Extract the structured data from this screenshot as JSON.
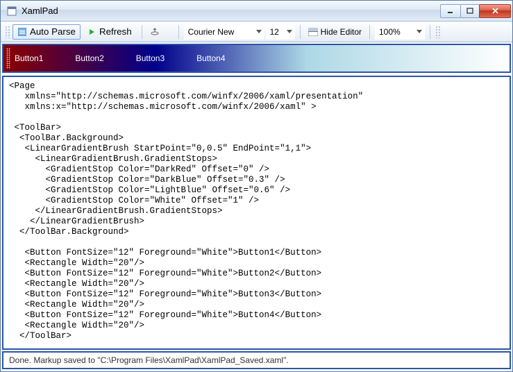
{
  "window": {
    "title": "XamlPad"
  },
  "toolbar": {
    "auto_parse": "Auto Parse",
    "refresh": "Refresh",
    "font": "Courier New",
    "font_size": "12",
    "hide_editor": "Hide Editor",
    "zoom": "100%"
  },
  "preview": {
    "buttons": [
      "Button1",
      "Button2",
      "Button3",
      "Button4"
    ]
  },
  "code": "<Page\n   xmlns=\"http://schemas.microsoft.com/winfx/2006/xaml/presentation\"\n   xmlns:x=\"http://schemas.microsoft.com/winfx/2006/xaml\" >\n\n <ToolBar>\n  <ToolBar.Background>\n   <LinearGradientBrush StartPoint=\"0,0.5\" EndPoint=\"1,1\">\n     <LinearGradientBrush.GradientStops>\n       <GradientStop Color=\"DarkRed\" Offset=\"0\" />\n       <GradientStop Color=\"DarkBlue\" Offset=\"0.3\" />\n       <GradientStop Color=\"LightBlue\" Offset=\"0.6\" />\n       <GradientStop Color=\"White\" Offset=\"1\" />\n     </LinearGradientBrush.GradientStops>\n    </LinearGradientBrush>\n  </ToolBar.Background>\n\n   <Button FontSize=\"12\" Foreground=\"White\">Button1</Button>\n   <Rectangle Width=\"20\"/>\n   <Button FontSize=\"12\" Foreground=\"White\">Button2</Button>\n   <Rectangle Width=\"20\"/>\n   <Button FontSize=\"12\" Foreground=\"White\">Button3</Button>\n   <Rectangle Width=\"20\"/>\n   <Button FontSize=\"12\" Foreground=\"White\">Button4</Button>\n   <Rectangle Width=\"20\"/>\n  </ToolBar>\n\n</Page>",
  "status": "Done. Markup saved to \"C:\\Program Files\\XamlPad\\XamlPad_Saved.xaml\"."
}
